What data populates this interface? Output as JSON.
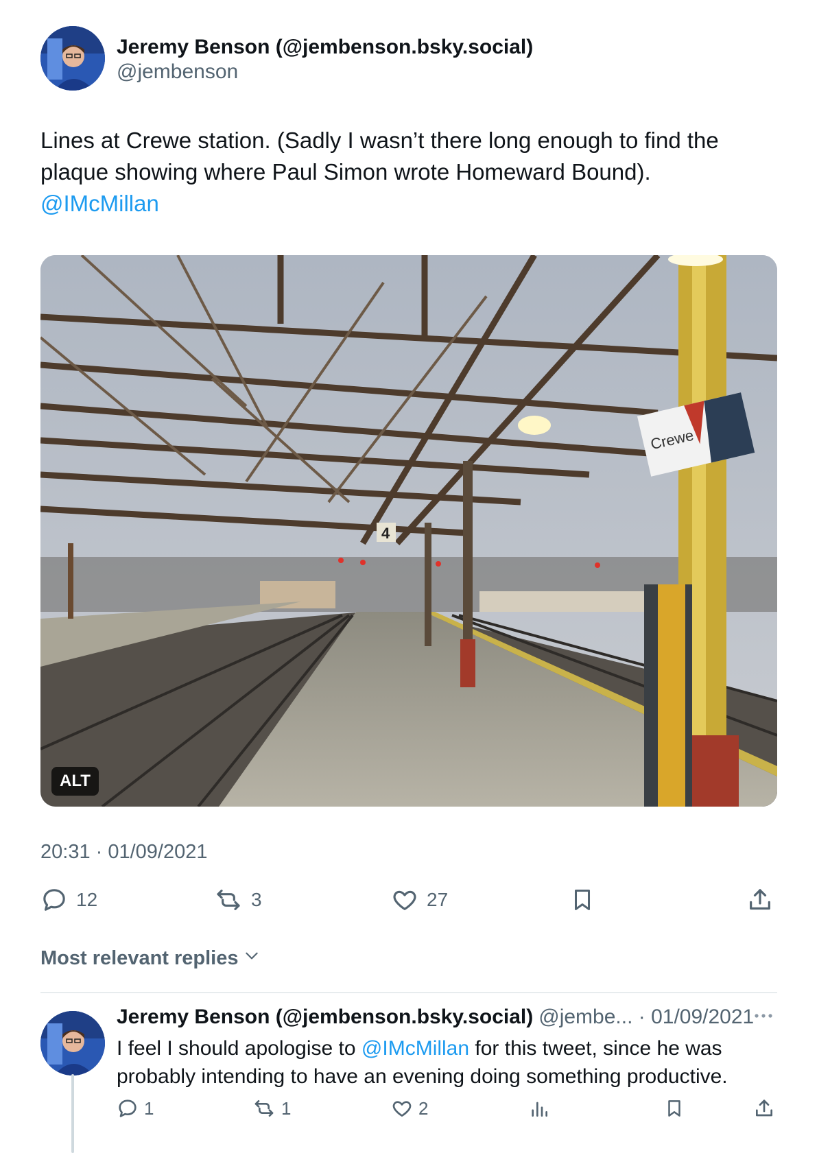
{
  "tweet": {
    "author_name": "Jeremy Benson (@jembenson.bsky.social)",
    "handle": "@jembenson",
    "text_line1": "Lines at Crewe station. (Sadly I wasn’t there long enough to find the",
    "text_line2": "plaque showing where Paul Simon wrote Homeward Bound).",
    "mention": "@IMcMillan",
    "image_alt_badge": "ALT",
    "sign_text": "Crewe",
    "platform_number": "4",
    "timestamp": "20:31 · 01/09/2021",
    "stats": {
      "replies": "12",
      "reposts": "3",
      "likes": "27"
    }
  },
  "replies_sort": {
    "label": "Most relevant replies",
    "icon": "chevron-down-icon"
  },
  "reply": {
    "author_name": "Jeremy Benson (@jembenson.bsky.social)",
    "meta": "@jembe... · 01/09/2021",
    "text_before": "I feel I should apologise to ",
    "mention": "@IMcMillan",
    "text_after": " for this tweet, since he was probably intending to have an evening doing something productive.",
    "stats": {
      "replies": "1",
      "reposts": "1",
      "likes": "2"
    }
  },
  "colors": {
    "accent": "#1d9bf0",
    "secondary_text": "#536471",
    "primary_text": "#0f1419",
    "divider": "#cfd9de"
  },
  "icons": [
    "reply-icon",
    "repost-icon",
    "like-icon",
    "bookmark-icon",
    "share-icon",
    "views-icon",
    "more-icon",
    "chevron-down-icon"
  ]
}
